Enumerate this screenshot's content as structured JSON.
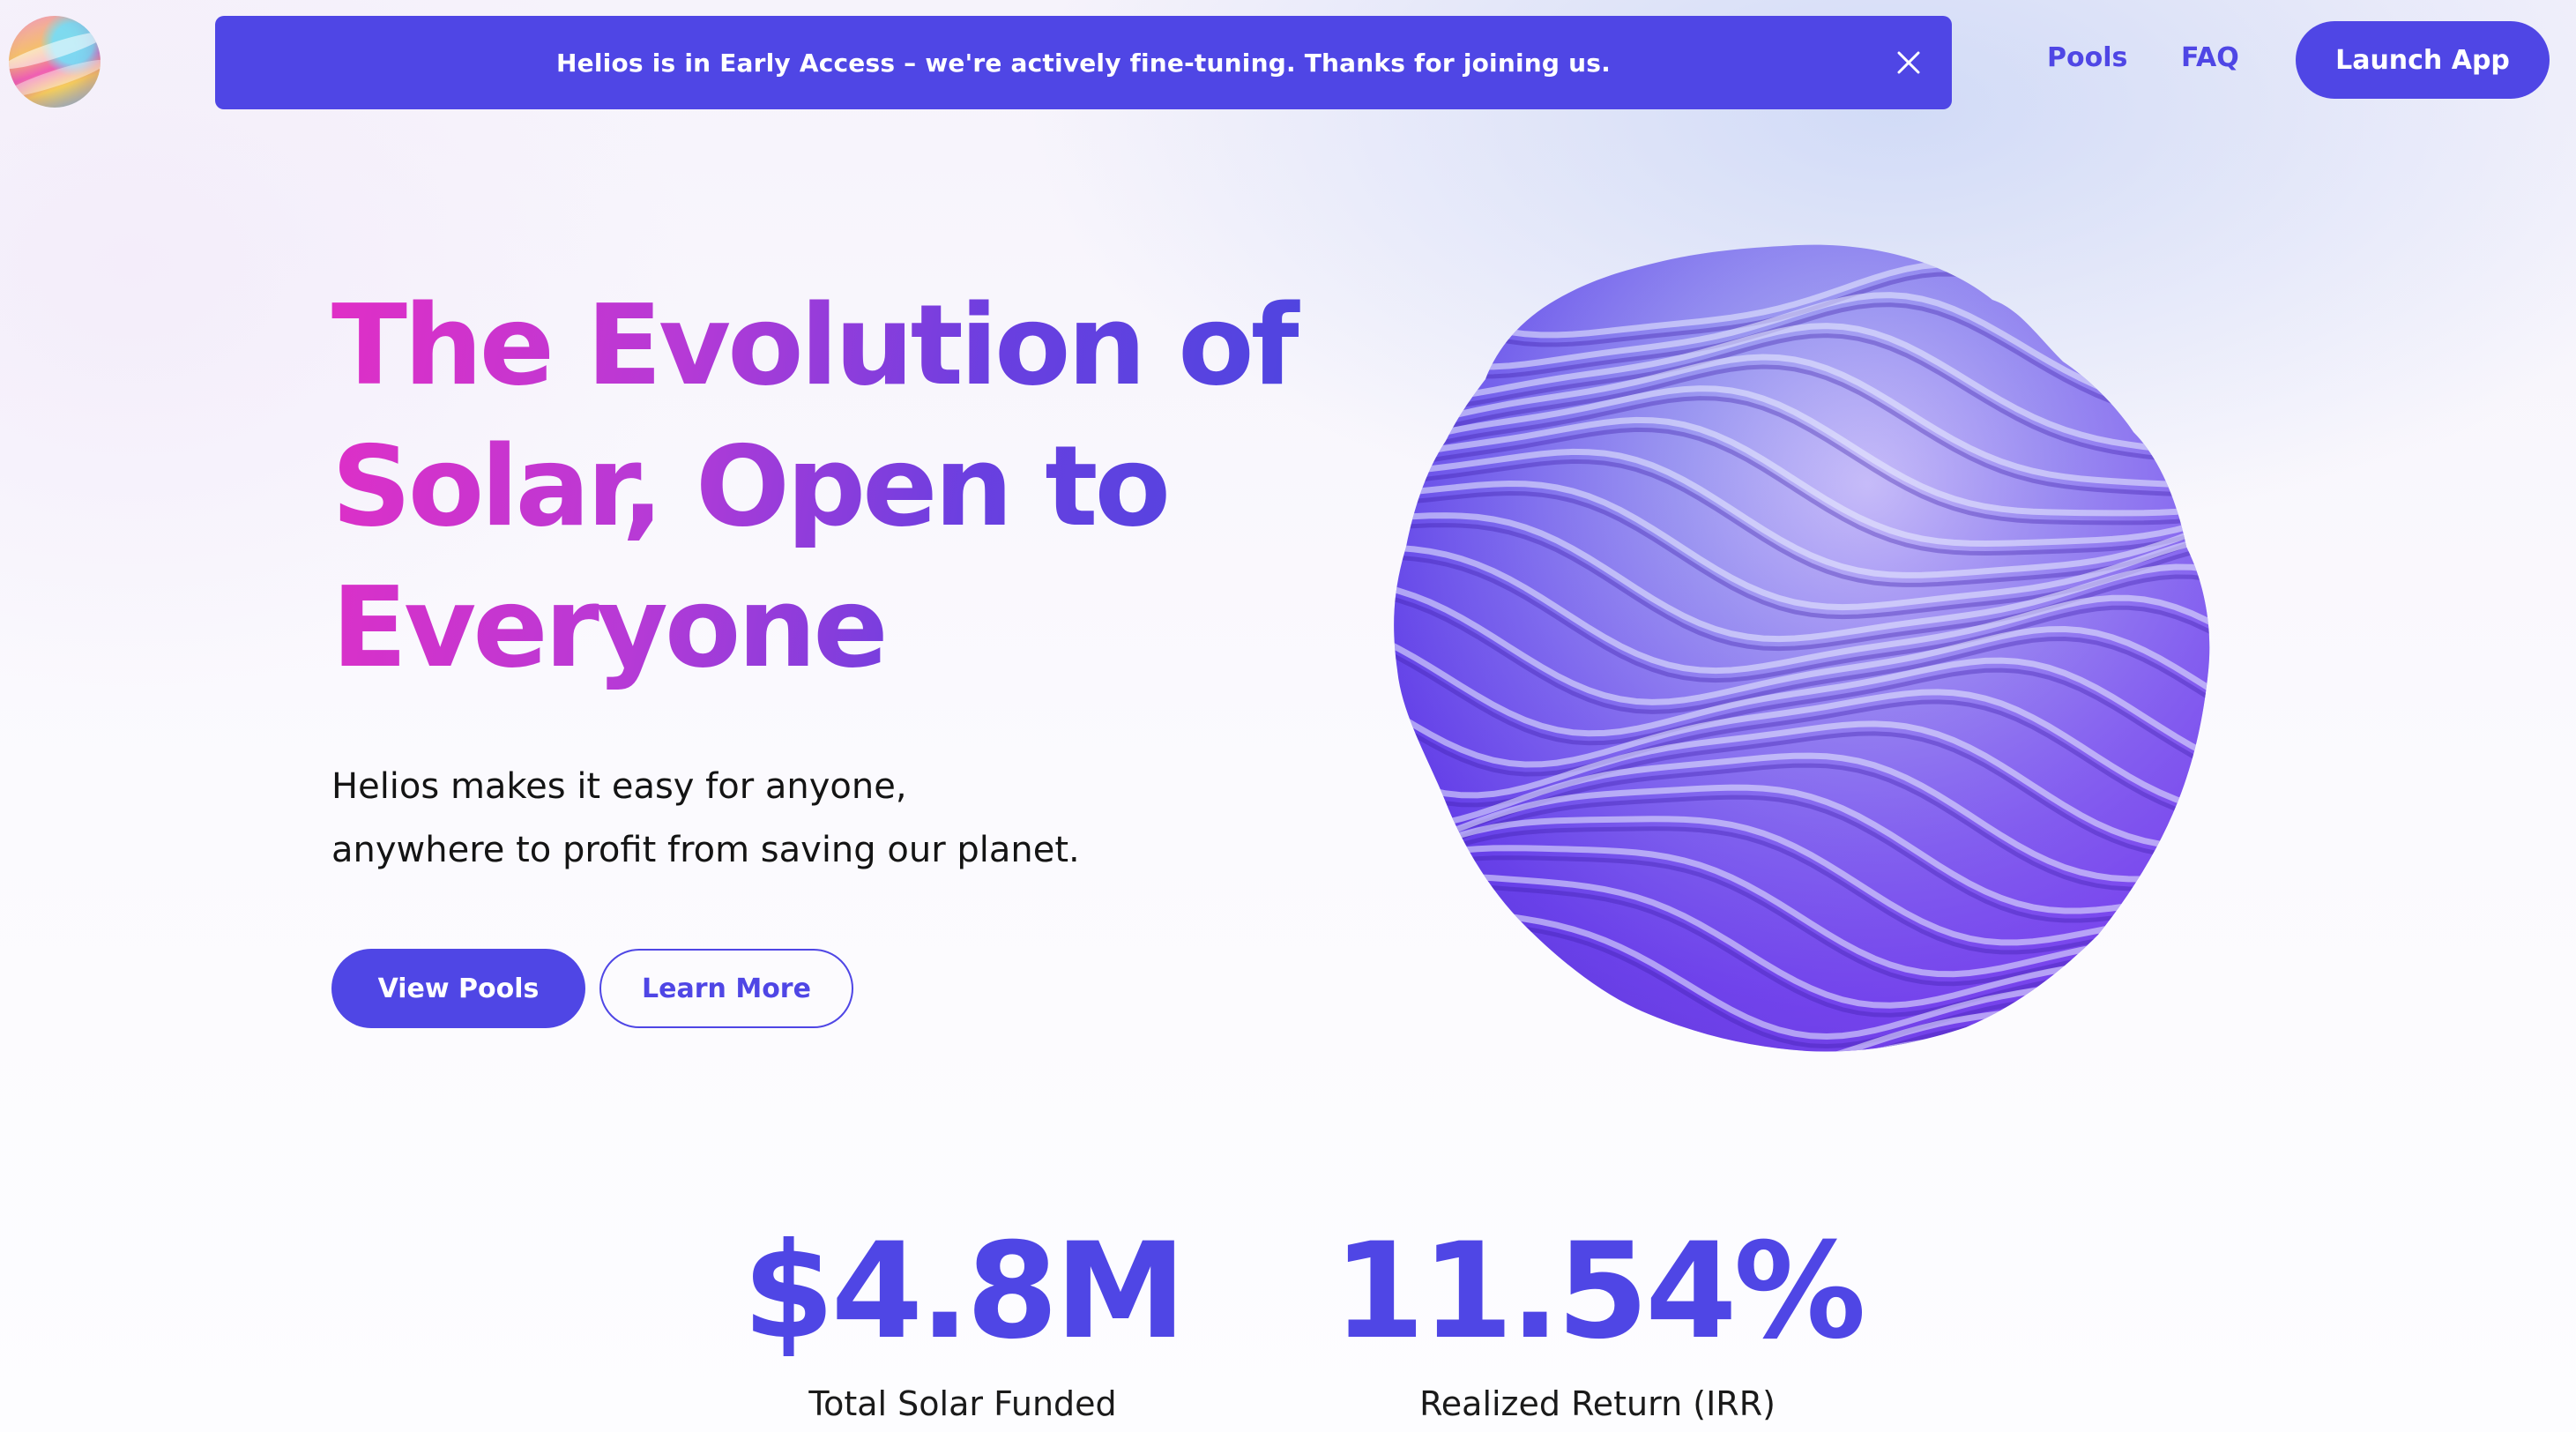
{
  "brand": {
    "logo_icon": "helios-sphere-logo"
  },
  "banner": {
    "message": "Helios is in Early Access – we're actively fine-tuning. Thanks for joining us.",
    "close_icon": "close-icon"
  },
  "nav": {
    "pools": "Pools",
    "faq": "FAQ",
    "launch_app": "Launch App"
  },
  "hero": {
    "title_lines": [
      "The Evolution of",
      "Solar, Open to",
      "Everyone"
    ],
    "subtitle_lines": [
      "Helios makes it easy for anyone,",
      "anywhere to profit from saving our planet."
    ],
    "primary_button": "View Pools",
    "secondary_button": "Learn More",
    "illustration": "wavy-sphere-illustration"
  },
  "stats": [
    {
      "value": "$4.8M",
      "label": "Total Solar Funded"
    },
    {
      "value": "11.54%",
      "label": "Realized Return (IRR)"
    }
  ],
  "colors": {
    "accent": "#4f46e5",
    "title_gradient_start": "#e02fc6",
    "title_gradient_end": "#4a46e0",
    "text": "#141414"
  }
}
